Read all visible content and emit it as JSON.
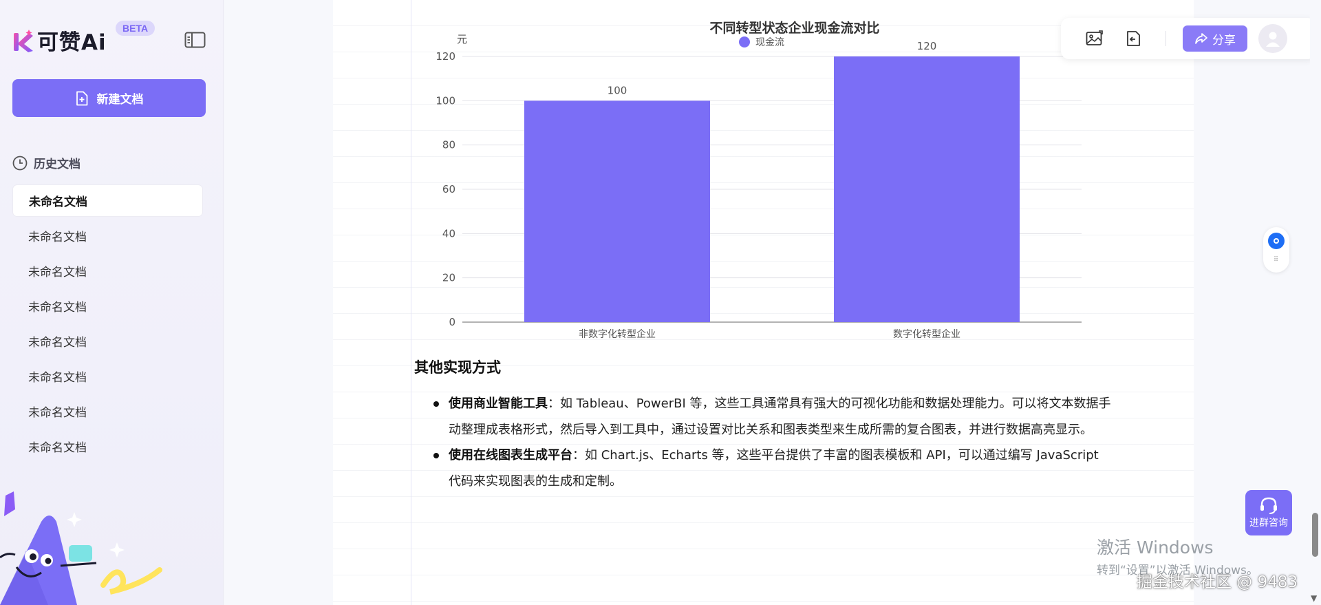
{
  "sidebar": {
    "logo_text": "可赞Ai",
    "beta_badge": "BETA",
    "new_doc_label": "新建文档",
    "history_label": "历史文档",
    "items": [
      "未命名文档",
      "未命名文档",
      "未命名文档",
      "未命名文档",
      "未命名文档",
      "未命名文档",
      "未命名文档",
      "未命名文档"
    ]
  },
  "toolbar": {
    "share_label": "分享",
    "icons": [
      "image-export-icon",
      "back-icon",
      "share-icon",
      "user-avatar-icon"
    ]
  },
  "chart_data": {
    "type": "bar",
    "title": "不同转型状态企业现金流对比",
    "ylabel": "元",
    "xlabel": "",
    "categories": [
      "非数字化转型企业",
      "数字化转型企业"
    ],
    "series": [
      {
        "name": "现金流",
        "values": [
          100,
          120
        ]
      }
    ],
    "ylim": [
      0,
      120
    ],
    "yticks": [
      0,
      20,
      40,
      60,
      80,
      100,
      120
    ],
    "data_labels": [
      "100",
      "120"
    ],
    "grid": true,
    "legend_position": "top",
    "bar_color": "#7b6ef6"
  },
  "content": {
    "section_title": "其他实现方式",
    "bullet1_bold": "使用商业智能工具",
    "bullet1_text": "：如 Tableau、PowerBI 等，这些工具通常具有强大的可视化功能和数据处理能力。可以将文本数据手动整理成表格形式，然后导入到工具中，通过设置对比关系和图表类型来生成所需的复合图表，并进行数据高亮显示。",
    "bullet2_bold": "使用在线图表生成平台",
    "bullet2_text": "：如 Chart.js、Echarts 等，这些平台提供了丰富的图表模板和 API，可以通过编写 JavaScript 代码来实现图表的生成和定制。"
  },
  "floating": {
    "consult_label": "进群咨询"
  },
  "watermark": {
    "activate_title": "激活 Windows",
    "activate_sub": "转到“设置”以激活 Windows。",
    "juejin": "掘金技术社区 @ 9483"
  }
}
